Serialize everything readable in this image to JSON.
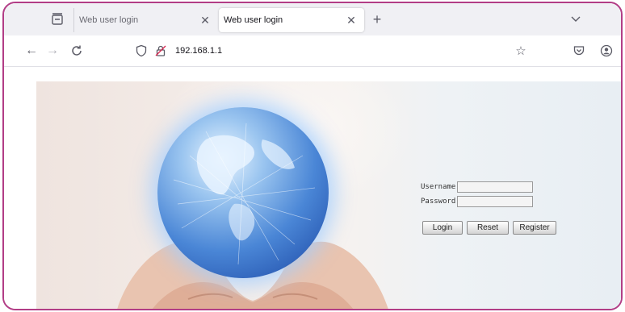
{
  "browser": {
    "tabs": [
      {
        "title": "Web user login",
        "active": false
      },
      {
        "title": "Web user login",
        "active": true
      }
    ],
    "url": "192.168.1.1",
    "icons": [
      "tab-list-icon",
      "close-icon",
      "new-tab-icon",
      "tabs-menu-icon",
      "back-icon",
      "forward-icon",
      "reload-icon",
      "shield-icon",
      "lock-icon",
      "star-icon",
      "pocket-icon",
      "account-icon"
    ]
  },
  "login": {
    "username_label": "Username",
    "password_label": "Password",
    "username_value": "",
    "password_value": "",
    "login_button": "Login",
    "reset_button": "Reset",
    "register_button": "Register"
  },
  "colors": {
    "frame_border": "#b23d86",
    "globe": "#4a86d6"
  }
}
